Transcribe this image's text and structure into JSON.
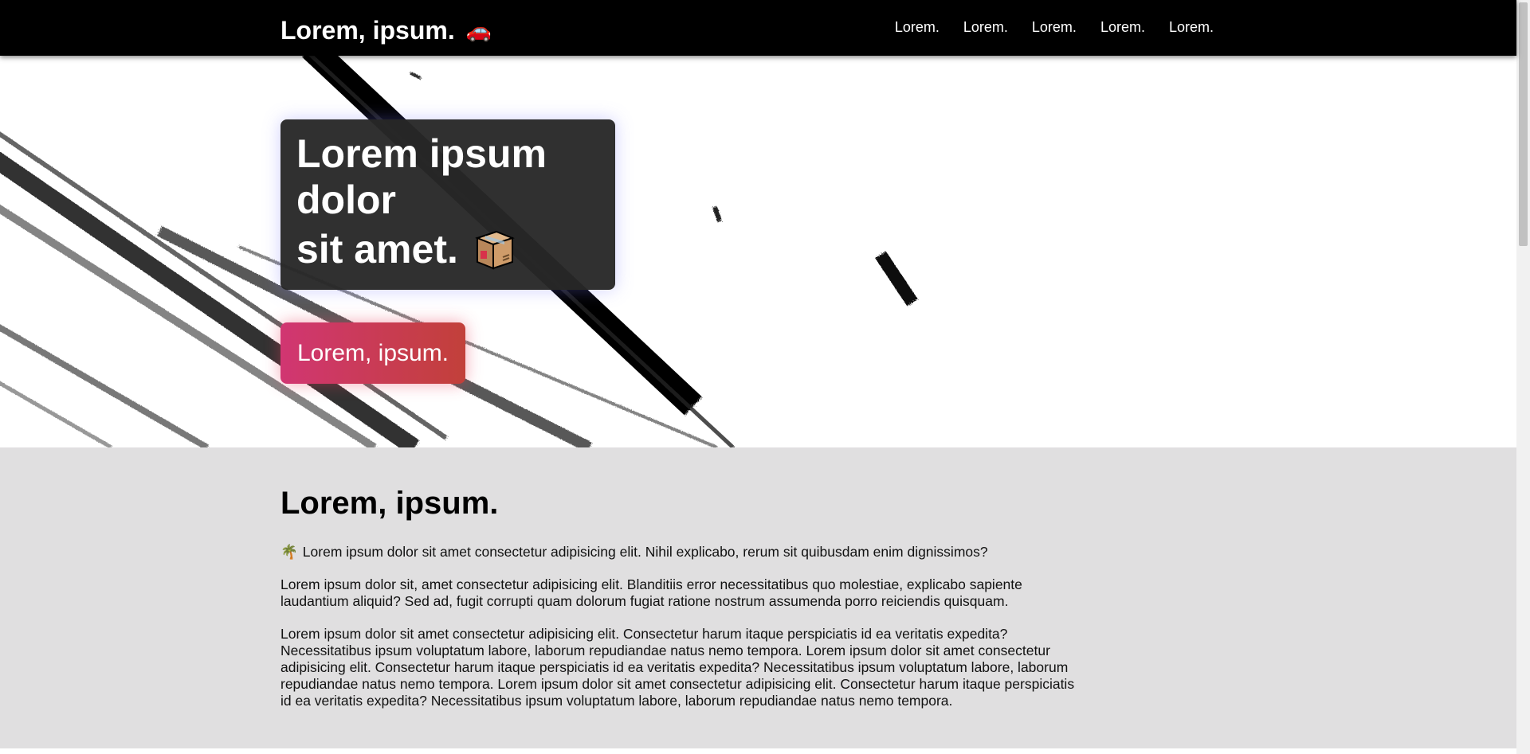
{
  "header": {
    "brand": "Lorem, ipsum.",
    "brand_icon": "car-icon",
    "nav": [
      "Lorem.",
      "Lorem.",
      "Lorem.",
      "Lorem.",
      "Lorem."
    ]
  },
  "hero": {
    "title_line1": "Lorem ipsum",
    "title_line2": "dolor",
    "title_line3": "sit amet.",
    "title_icon": "package-icon",
    "cta_label": "Lorem, ipsum."
  },
  "content": {
    "heading": "Lorem, ipsum.",
    "p1_icon": "palm-tree-icon",
    "p1": "Lorem ipsum dolor sit amet consectetur adipisicing elit. Nihil explicabo, rerum sit quibusdam enim dignissimos?",
    "p2": "Lorem ipsum dolor sit, amet consectetur adipisicing elit. Blanditiis error necessitatibus quo molestiae, explicabo sapiente laudantium aliquid? Sed ad, fugit corrupti quam dolorum fugiat ratione nostrum assumenda porro reiciendis quisquam.",
    "p3": "Lorem ipsum dolor sit amet consectetur adipisicing elit. Consectetur harum itaque perspiciatis id ea veritatis expedita? Necessitatibus ipsum voluptatum labore, laborum repudiandae natus nemo tempora. Lorem ipsum dolor sit amet consectetur adipisicing elit. Consectetur harum itaque perspiciatis id ea veritatis expedita? Necessitatibus ipsum voluptatum labore, laborum repudiandae natus nemo tempora. Lorem ipsum dolor sit amet consectetur adipisicing elit. Consectetur harum itaque perspiciatis id ea veritatis expedita? Necessitatibus ipsum voluptatum labore, laborum repudiandae natus nemo tempora."
  },
  "colors": {
    "header_bg": "#000000",
    "cta_gradient_start": "#d13672",
    "cta_gradient_end": "#c2403a",
    "content_bg": "#e0dfe0"
  }
}
